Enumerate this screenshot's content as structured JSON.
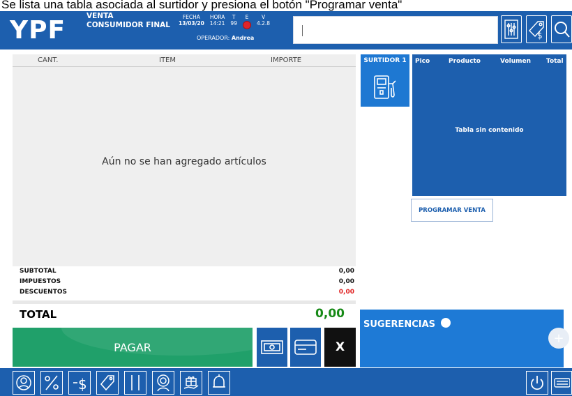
{
  "caption": "Se lista una tabla asociada al surtidor y presiona el botón \"Programar venta\"",
  "header": {
    "logo": "YPF",
    "mode_line1": "VENTA",
    "mode_line2": "CONSUMIDOR FINAL",
    "fecha_label": "FECHA",
    "fecha_value": "13/03/20",
    "hora_label": "HORA",
    "hora_value": "14:21",
    "t_label": "T",
    "t_value": "99",
    "e_label": "E",
    "v_label": "V",
    "v_value": "4.2.8",
    "operator_label": "OPERADOR:",
    "operator_name": "Andrea",
    "search_value": ""
  },
  "cart": {
    "col_cant": "CANT.",
    "col_item": "ITEM",
    "col_importe": "IMPORTE",
    "empty_message": "Aún no se han agregado artículos"
  },
  "totals": {
    "subtotal_label": "SUBTOTAL",
    "subtotal_value": "0,00",
    "impuestos_label": "IMPUESTOS",
    "impuestos_value": "0,00",
    "descuentos_label": "DESCUENTOS",
    "descuentos_value": "0,00",
    "total_label": "TOTAL",
    "total_value": "0,00"
  },
  "actions": {
    "pay_label": "PAGAR",
    "cancel_label": "X"
  },
  "pump": {
    "surtidor_label": "SURTIDOR 1",
    "table_headers": [
      "Pico",
      "Producto",
      "Volumen",
      "Total"
    ],
    "empty_table": "Tabla sin contenido",
    "program_label": "PROGRAMAR VENTA"
  },
  "suggestions": {
    "label": "SUGERENCIAS",
    "add": "+"
  },
  "colors": {
    "brand_blue": "#1d5fae",
    "pay_green": "#20a06a",
    "total_green": "#178a17",
    "discount_red": "#e02020"
  }
}
